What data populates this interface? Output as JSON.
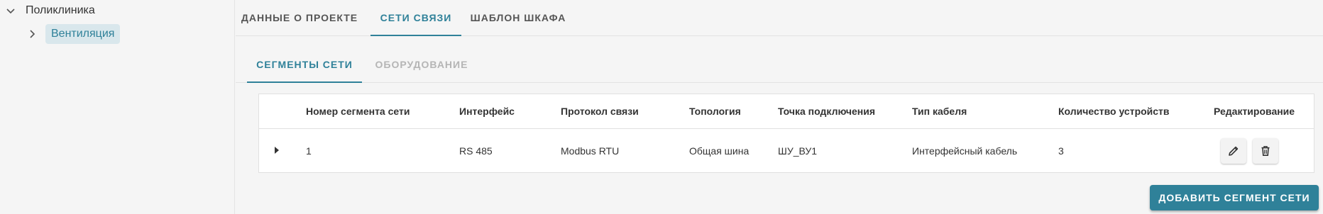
{
  "tree": {
    "root": {
      "label": "Поликлиника",
      "icon": "chevron-down-icon"
    },
    "child": {
      "label": "Вентиляция",
      "icon": "chevron-right-icon"
    }
  },
  "tabs": [
    {
      "label": "Данные о проекте",
      "active": false
    },
    {
      "label": "Сети связи",
      "active": true
    },
    {
      "label": "Шаблон шкафа",
      "active": false
    }
  ],
  "subtabs": [
    {
      "label": "Сегменты сети",
      "active": true
    },
    {
      "label": "Оборудование",
      "active": false
    }
  ],
  "table": {
    "columns": [
      "Номер сегмента сети",
      "Интерфейс",
      "Протокол связи",
      "Топология",
      "Точка подключения",
      "Тип кабеля",
      "Количество устройств",
      "Редактирование"
    ],
    "rows": [
      {
        "segment": "1",
        "interface": "RS 485",
        "protocol": "Modbus RTU",
        "topology": "Общая шина",
        "connection_point": "ШУ_ВУ1",
        "cable_type": "Интерфейсный кабель",
        "device_count": "3",
        "actions": [
          "pencil-icon",
          "trash-icon"
        ]
      }
    ]
  },
  "add_button": {
    "label": "Добавить сегмент сети"
  },
  "colors": {
    "accent": "#2f8199",
    "selected_bg": "#d9e7ec",
    "inactive_tab": "#b5b5b5"
  }
}
